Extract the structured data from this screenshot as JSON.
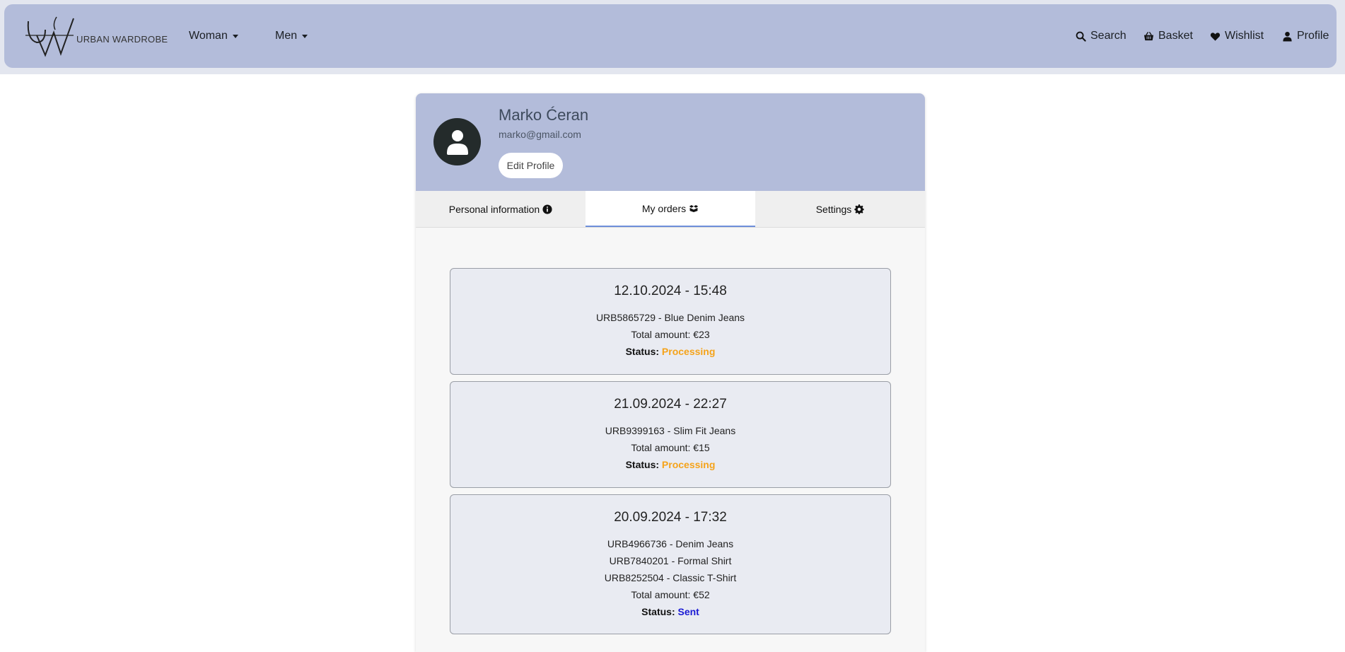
{
  "brand": {
    "name": "URBAN WARDROBE"
  },
  "nav": {
    "woman": "Woman",
    "men": "Men",
    "search": "Search",
    "basket": "Basket",
    "wishlist": "Wishlist",
    "profile": "Profile"
  },
  "user": {
    "name": "Marko Ćeran",
    "email": "marko@gmail.com",
    "edit_label": "Edit Profile"
  },
  "tabs": [
    {
      "label": "Personal information",
      "icon": "info-circle-icon"
    },
    {
      "label": "My orders",
      "icon": "box-icon",
      "active": true
    },
    {
      "label": "Settings",
      "icon": "gear-icon"
    }
  ],
  "status_label": "Status:",
  "orders": [
    {
      "date": "12.10.2024 - 15:48",
      "items": [
        "URB5865729 - Blue Denim Jeans"
      ],
      "total": "Total amount: €23",
      "status": "Processing"
    },
    {
      "date": "21.09.2024 - 22:27",
      "items": [
        "URB9399163 - Slim Fit Jeans"
      ],
      "total": "Total amount: €15",
      "status": "Processing"
    },
    {
      "date": "20.09.2024 - 17:32",
      "items": [
        "URB4966736 - Denim Jeans",
        "URB7840201 - Formal Shirt",
        "URB8252504 - Classic T-Shirt"
      ],
      "total": "Total amount: €52",
      "status": "Sent"
    }
  ],
  "colors": {
    "navbar": "#b3bcda",
    "processing": "#f5a31a",
    "sent": "#1a1ad4",
    "active_tab_underline": "#6e8fda"
  }
}
